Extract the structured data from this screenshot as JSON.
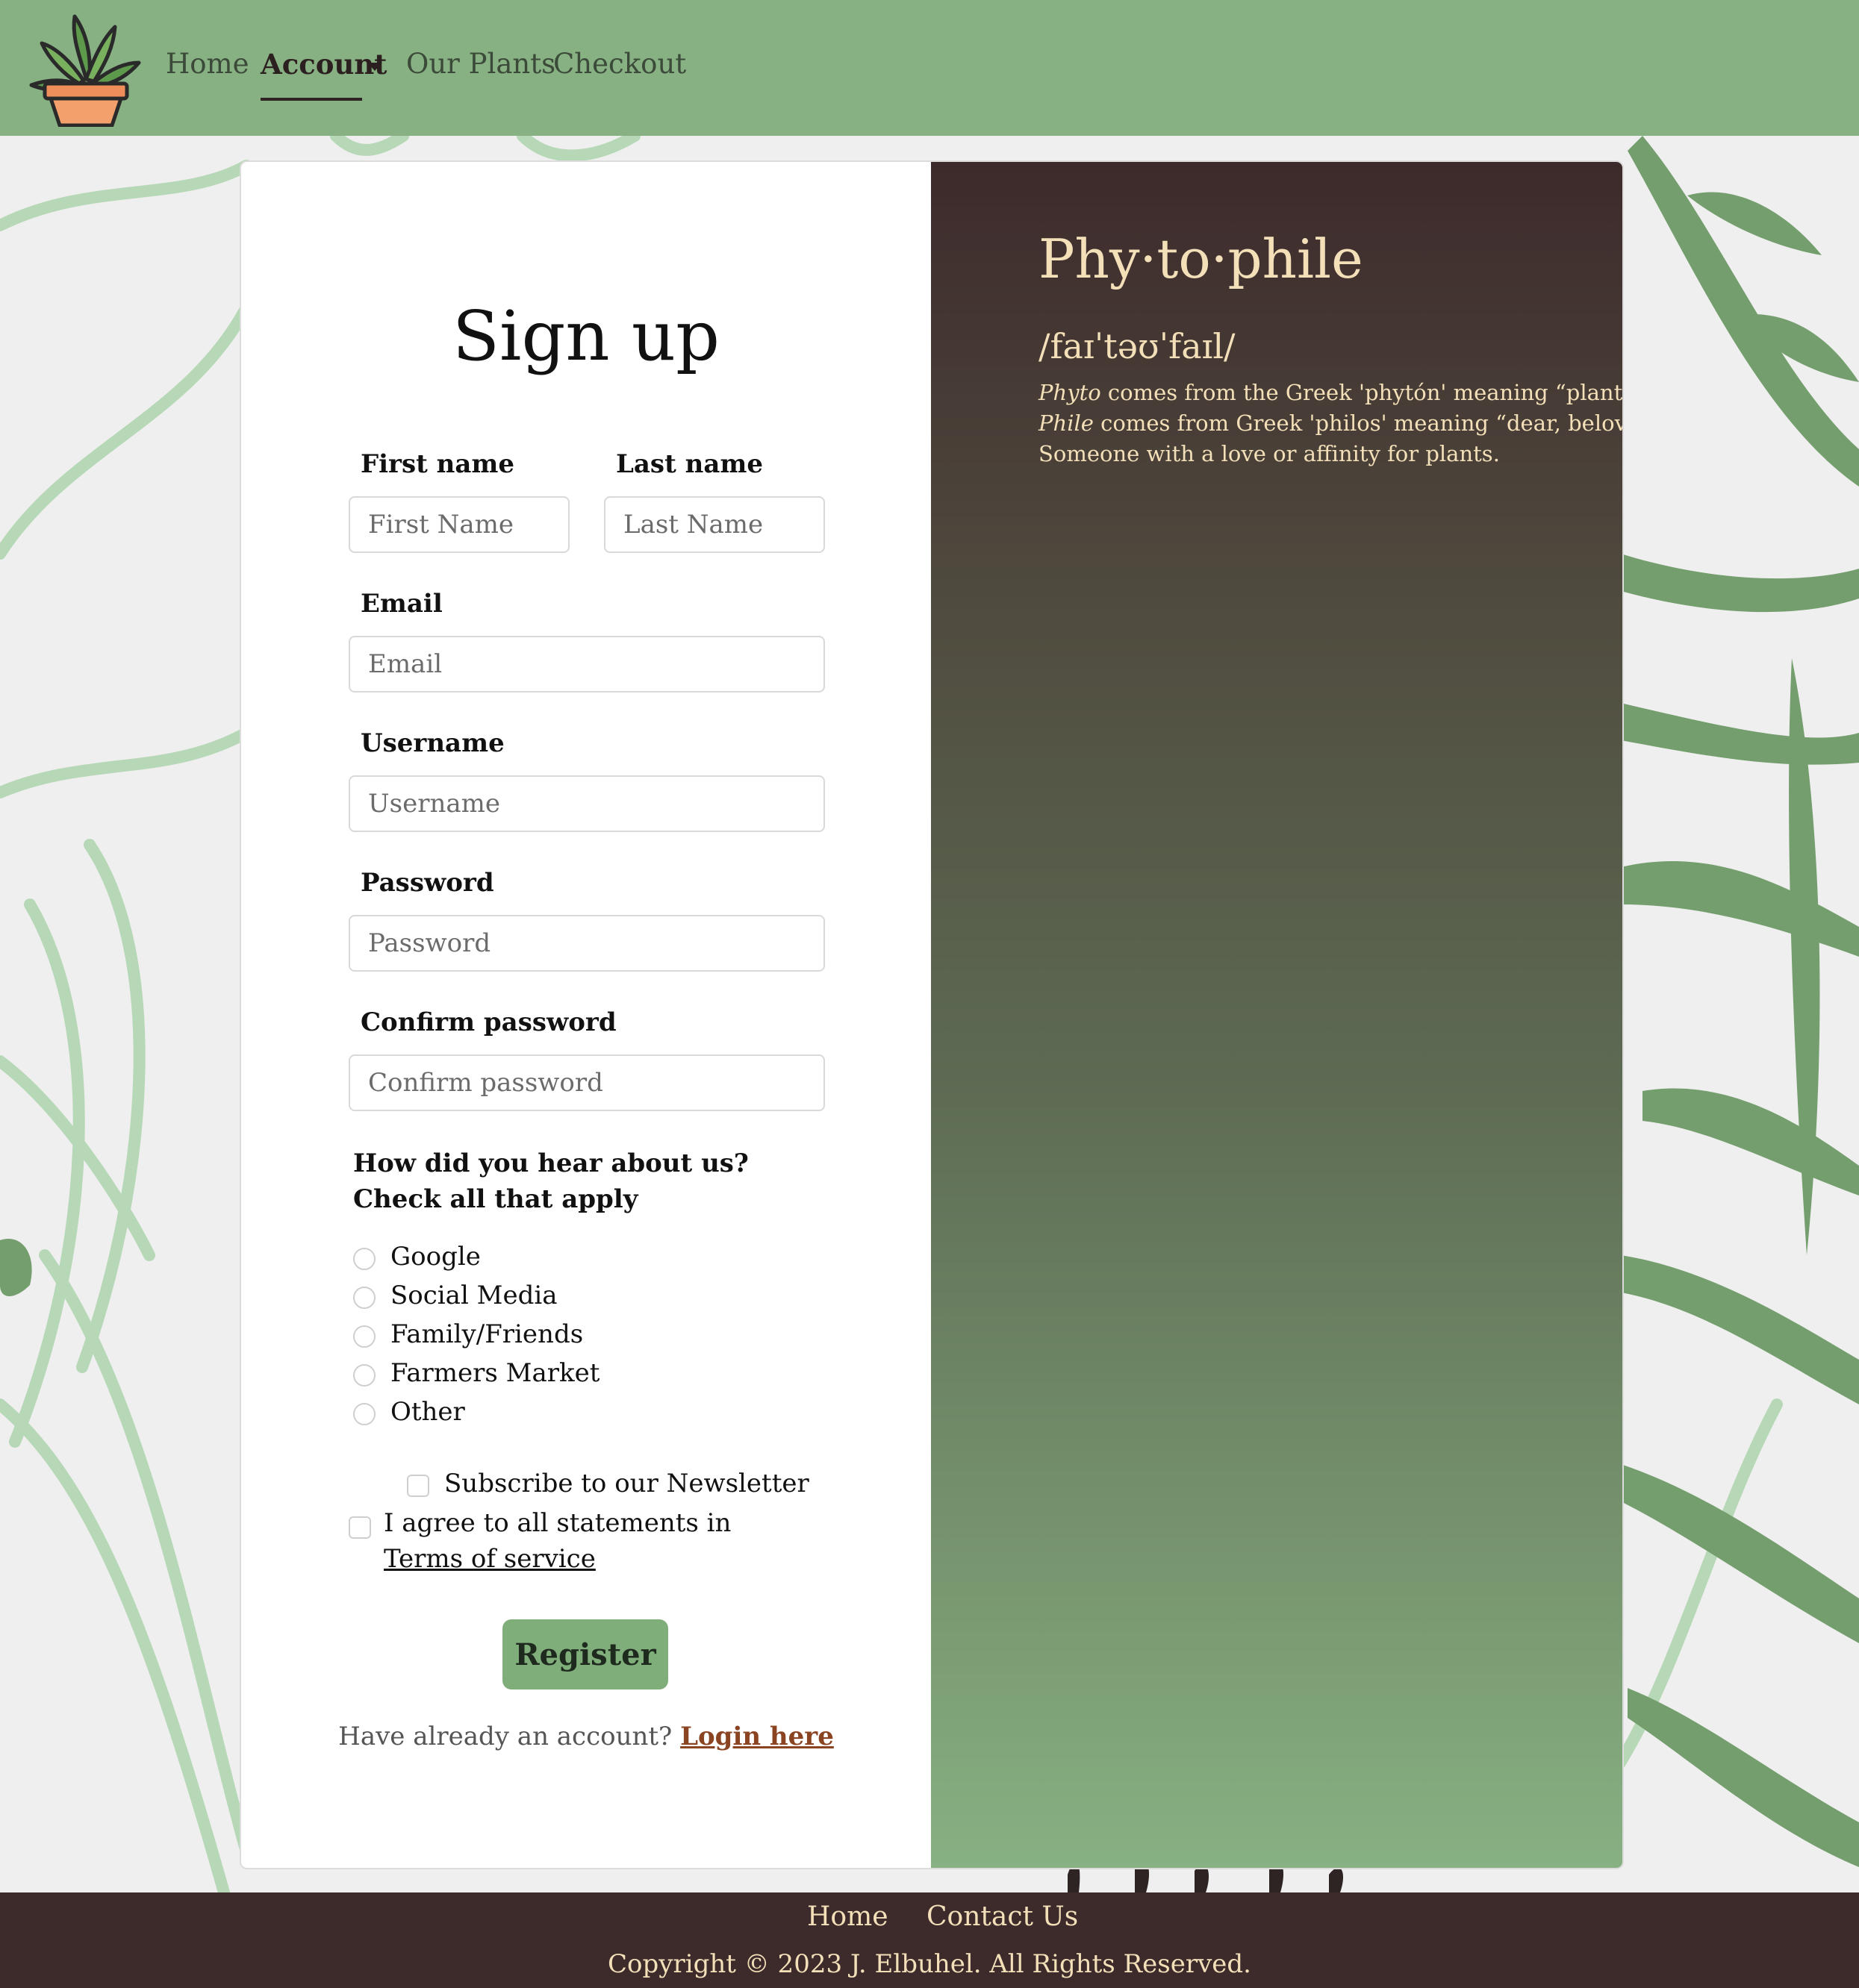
{
  "nav": {
    "links": [
      "Home",
      "Account",
      "Our Plants",
      "Checkout"
    ],
    "active": "Account",
    "logo_icon": "potted-plant-logo"
  },
  "form": {
    "title": "Sign up",
    "first_name": {
      "label": "First name",
      "placeholder": "First Name",
      "value": ""
    },
    "last_name": {
      "label": "Last name",
      "placeholder": "Last Name",
      "value": ""
    },
    "email": {
      "label": "Email",
      "placeholder": "Email",
      "value": ""
    },
    "username": {
      "label": "Username",
      "placeholder": "Username",
      "value": ""
    },
    "password": {
      "label": "Password",
      "placeholder": "Password",
      "value": ""
    },
    "confirm_password": {
      "label": "Confirm password",
      "placeholder": "Confirm password",
      "value": ""
    },
    "question": "How did you hear about us? Check all that apply",
    "sources": [
      "Google",
      "Social Media",
      "Family/Friends",
      "Farmers Market",
      "Other"
    ],
    "newsletter_label": "Subscribe to our Newsletter",
    "tos_prefix": "I agree to all statements in ",
    "tos_link": "Terms of service",
    "register_label": "Register",
    "login_prompt": "Have already an account? ",
    "login_link": "Login here"
  },
  "definition": {
    "word": "Phy·to·phile",
    "pronunciation": "/faɪˈtəʊˈfaɪl/",
    "line1_term": "Phyto",
    "line1_rest": " comes from the Greek 'phytón' meaning “plant”.",
    "line2_term": "Phile",
    "line2_rest": " comes from Greek 'philos' meaning “dear, beloved”.",
    "line3": "Someone with a love or affinity for plants."
  },
  "footer": {
    "links": [
      "Home",
      "Contact Us"
    ],
    "copyright": "Copyright © 2023 J. Elbuhel. All Rights Reserved."
  },
  "colors": {
    "nav_bg": "#87b083",
    "dark_brown": "#3d2a2b",
    "cream": "#f3e0b9",
    "button_green": "#7fae7a",
    "link_rust": "#8a4422"
  }
}
